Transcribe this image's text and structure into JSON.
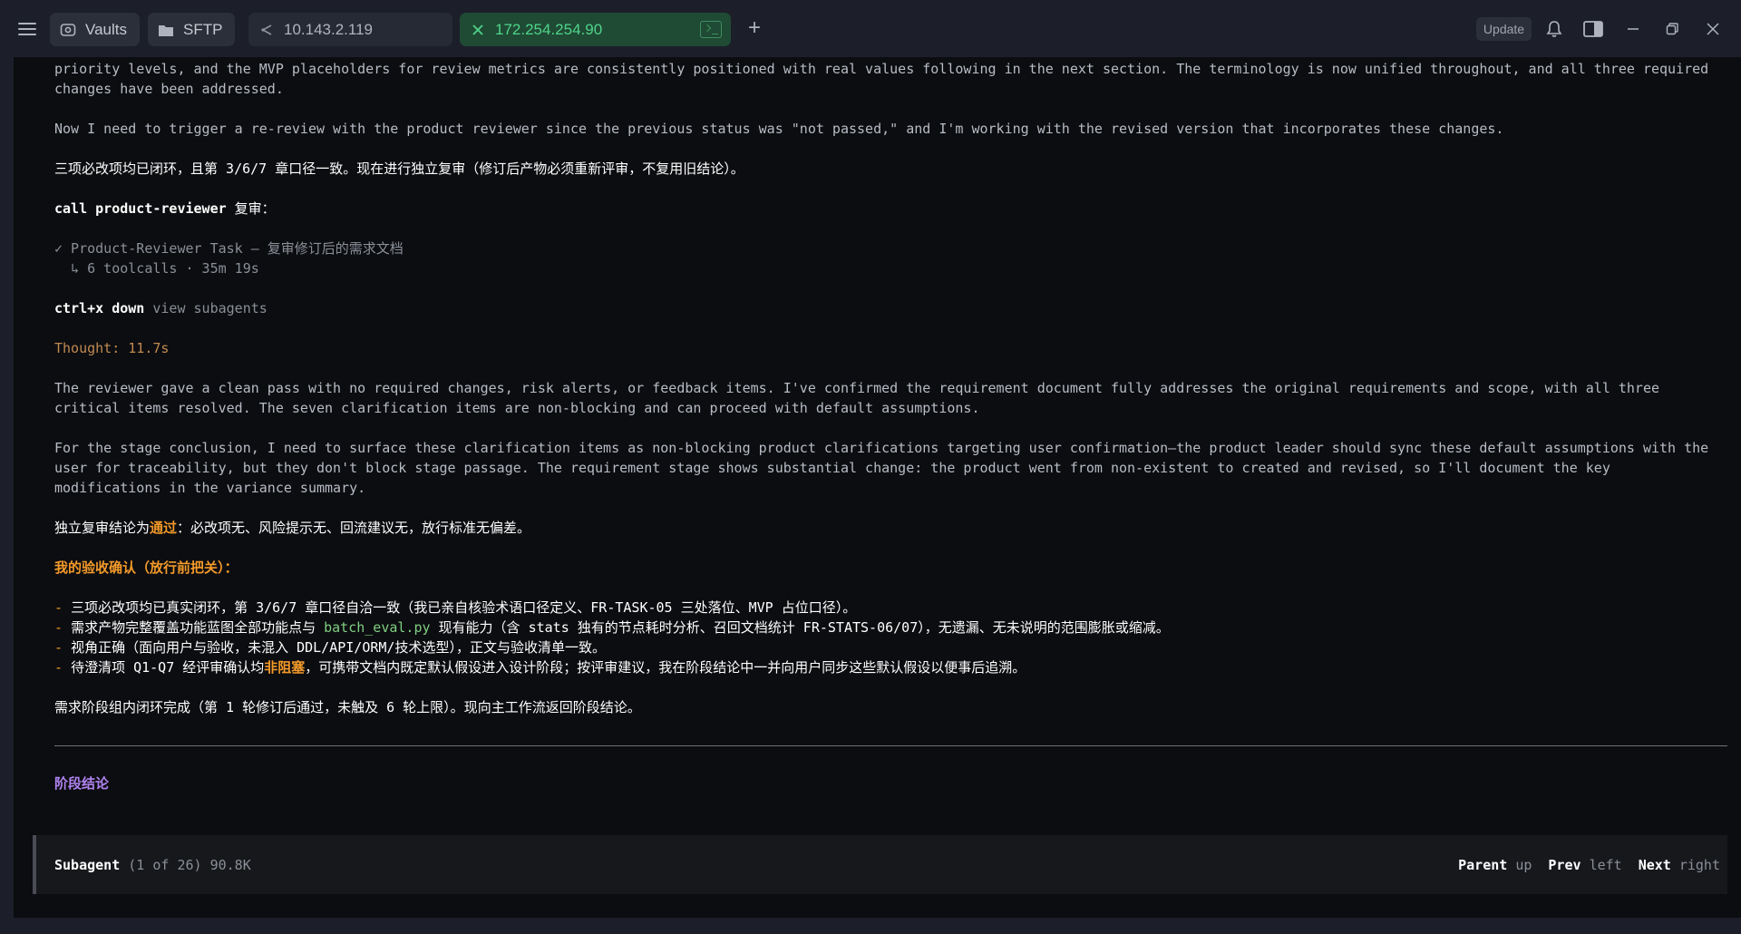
{
  "tabs": {
    "vaults": "Vaults",
    "sftp": "SFTP",
    "host1": "10.143.2.119",
    "host2": "172.254.254.90"
  },
  "toolbar": {
    "update": "Update"
  },
  "terminal": {
    "lines": {
      "l1": "priority levels, and the MVP placeholders for review metrics are consistently positioned with real values following in the next section. The terminology is now unified throughout, and all three required",
      "l2": "changes have been addressed.",
      "l3": "Now I need to trigger a re-review with the product reviewer since the previous status was \"not passed,\" and I'm working with the revised version that incorporates these changes.",
      "l4": "三项必改项均已闭环，且第 3/6/7 章口径一致。现在进行独立复审（修订后产物必须重新评审，不复用旧结论）。",
      "l5_cmd": "call product-reviewer",
      "l5_rest": " 复审：",
      "l6": "✓ Product-Reviewer Task — 复审修订后的需求文档",
      "l7": "  ↳ 6 toolcalls · 35m 19s",
      "l8_key": "ctrl+x down",
      "l8_rest": " view subagents",
      "l9": "Thought: 11.7s",
      "l10": "The reviewer gave a clean pass with no required changes, risk alerts, or feedback items. I've confirmed the requirement document fully addresses the original requirements and scope, with all three",
      "l11": "critical items resolved. The seven clarification items are non-blocking and can proceed with default assumptions.",
      "l12": "For the stage conclusion, I need to surface these clarification items as non-blocking product clarifications targeting user confirmation—the product leader should sync these default assumptions with the",
      "l13": "user for traceability, but they don't block stage passage. The requirement stage shows substantial change: the product went from non-existent to created and revised, so I'll document the key",
      "l14": "modifications in the variance summary.",
      "l15a": "独立复审结论为",
      "l15b": "通过",
      "l15c": "：必改项无、风险提示无、回流建议无，放行标准无偏差。",
      "l16": "我的验收确认（放行前把关）：",
      "b1a": "- ",
      "b1b": "三项必改项均已真实闭环，第 3/6/7 章口径自洽一致（我已亲自核验术语口径定义、FR-TASK-05 三处落位、MVP 占位口径）。",
      "b2b": "需求产物完整覆盖功能蓝图全部功能点与 ",
      "b2c": "batch_eval.py",
      "b2d": " 现有能力（含 stats 独有的节点耗时分析、召回文档统计 FR-STATS-06/07），无遗漏、无未说明的范围膨胀或缩减。",
      "b3b": "视角正确（面向用户与验收，未混入 DDL/API/ORM/技术选型），正文与验收清单一致。",
      "b4b": "待澄清项 Q1-Q7 经评审确认均",
      "b4c": "非阻塞",
      "b4d": "，可携带文档内既定默认假设进入设计阶段；按评审建议，我在阶段结论中一并向用户同步这些默认假设以便事后追溯。",
      "l17": "需求阶段组内闭环完成（第 1 轮修订后通过，未触及 6 轮上限）。现向主工作流返回阶段结论。"
    },
    "stage_title": "阶段结论"
  },
  "statusbar": {
    "label": "Subagent",
    "info": " (1 of 26) 90.8K",
    "parent": "Parent",
    "parent_key": "up",
    "prev": "Prev",
    "prev_key": "left",
    "next": "Next",
    "next_key": "right"
  }
}
